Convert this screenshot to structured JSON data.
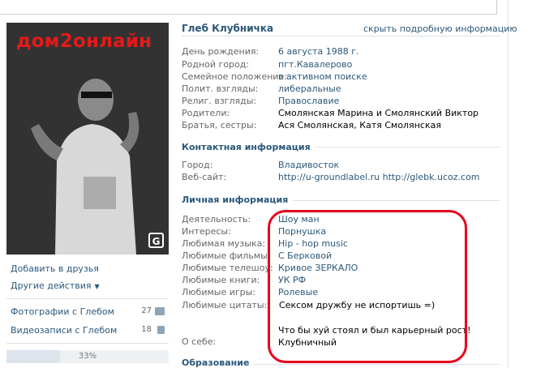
{
  "profile": {
    "name": "Глеб Клубничка",
    "hide_link": "скрыть подробную информацию",
    "photo_brand": "дом2онлайн",
    "photo_logo": "G",
    "info": [
      {
        "label": "День рождения:",
        "value": "6 августа 1988 г."
      },
      {
        "label": "Родной город:",
        "value": "пгт.Кавалерово"
      },
      {
        "label": "Семейное положение:",
        "value": "в активном поиске"
      },
      {
        "label": "Полит. взгляды:",
        "value": "либеральные"
      },
      {
        "label": "Религ. взгляды:",
        "value": "Православие"
      },
      {
        "label": "Родители:",
        "value": "Смолянская Марина и Смолянский Виктор"
      },
      {
        "label": "Братья, сестры:",
        "value": "Ася Смолянская, Катя Смолянская"
      }
    ]
  },
  "contact": {
    "title": "Контактная информация",
    "city_label": "Город:",
    "city": "Владивосток",
    "site_label": "Веб-сайт:",
    "site": "http://u-groundlabel.ru http://glebk.ucoz.com"
  },
  "personal": {
    "title": "Личная информация",
    "items": [
      {
        "label": "Деятельность:",
        "value": "Шоу ман"
      },
      {
        "label": "Интересы:",
        "value": "Порнушка"
      },
      {
        "label": "Любимая музыка:",
        "value": "Hip - hop music"
      },
      {
        "label": "Любимые фильмы:",
        "value": "С Берковой"
      },
      {
        "label": "Любимые телешоу:",
        "value": "Кривое ЗЕРКАЛО"
      },
      {
        "label": "Любимые книги:",
        "value": "УК РФ"
      },
      {
        "label": "Любимые игры:",
        "value": "Ролевые"
      }
    ],
    "quotes_label": "Любимые цитаты:",
    "quotes_value": "Сексом дружбу не испортишь =)",
    "about_label": "О себе:",
    "about_line1": "Что бы хуй стоял и был карьерный рост!",
    "about_line2": "Клубничный"
  },
  "education": {
    "title": "Образование"
  },
  "sidebar": {
    "add_friend": "Добавить в друзья",
    "other_actions": "Другие действия",
    "photos_label": "Фотографии с Глебом",
    "photos_count": "27",
    "videos_label": "Видеозаписи с Глебом",
    "videos_count": "18",
    "progress_text": "33%",
    "progress_value": 0.33
  },
  "colors": {
    "link": "#2b587a",
    "label": "#666666",
    "highlight": "#e8001c",
    "brand": "#e31a1a"
  },
  "icons": [
    "camera-icon",
    "video-icon",
    "chevron-down-icon"
  ]
}
